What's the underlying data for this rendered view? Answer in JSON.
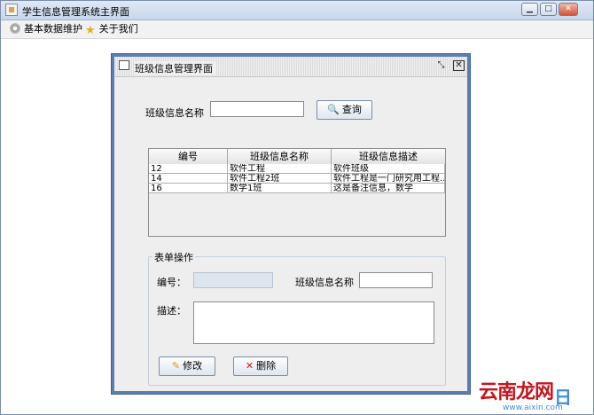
{
  "window": {
    "title": "学生信息管理系统主界面",
    "minimize": "▁",
    "maximize": "□",
    "close": "✕"
  },
  "menu": {
    "items": [
      {
        "label": "基本数据维护",
        "icon": "gear-icon"
      },
      {
        "label": "关于我们",
        "icon": "star-icon"
      }
    ]
  },
  "frame": {
    "title": "班级信息管理界面",
    "restore": "⤡",
    "close": "✕"
  },
  "search": {
    "label": "班级信息名称",
    "value": "",
    "button": "查询"
  },
  "table": {
    "columns": [
      "编号",
      "班级信息名称",
      "班级信息描述"
    ],
    "rows": [
      [
        "12",
        "软件工程",
        "软件班级"
      ],
      [
        "14",
        "软件工程2班",
        "软件工程是一门研究用工程..."
      ],
      [
        "16",
        "数学1班",
        "这是备注信息，数学"
      ]
    ]
  },
  "form": {
    "group_title": "表单操作",
    "id_label": "编号：",
    "id_value": "",
    "name_label": "班级信息名称",
    "name_value": "",
    "desc_label": "描述：",
    "desc_value": "",
    "modify_button": "修改",
    "delete_button": "删除"
  },
  "watermark": {
    "text": "云南龙网",
    "text2": "日",
    "url": "www.aixin.com"
  }
}
